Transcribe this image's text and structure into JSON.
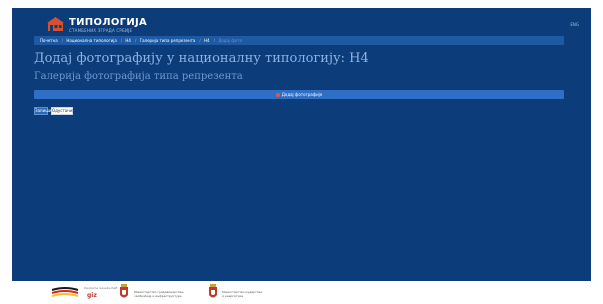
{
  "header": {
    "logo_title": "ТИПОЛОГИЈА",
    "logo_subtitle": "СТАМБЕНИХ ЗГРАДА СРБИЈЕ",
    "language": "ENG"
  },
  "breadcrumb": [
    {
      "label": "Почетна",
      "active": false
    },
    {
      "label": "Национална типологија",
      "active": false
    },
    {
      "label": "Н4",
      "active": false
    },
    {
      "label": "Галерија типа репрезента",
      "active": false
    },
    {
      "label": "Н4",
      "active": false
    },
    {
      "label": "Додај фото",
      "active": true
    }
  ],
  "page": {
    "title": "Додај фотографију у националну типологију: Н4",
    "subtitle": "Галерија фотографија типа репрезента"
  },
  "dropzone": {
    "label": "Додај фотографије"
  },
  "actions": {
    "save_label": "Запиши",
    "cancel_label": "Одустани"
  },
  "footer": {
    "giz_label": "giz",
    "giz_small": "Deutsche Gesellschaft",
    "ministry1_line1": "Министарство грађевинарства,",
    "ministry1_line2": "саобраћаја и инфраструктуре",
    "ministry2_line1": "Министарство рударства",
    "ministry2_line2": "и енергетике"
  },
  "colors": {
    "background": "#0c3c7a",
    "breadcrumb": "#1e5aa3",
    "dropzone": "#2f6fc5",
    "title": "#8fb2e3",
    "accent_roof": "#d9502f"
  }
}
